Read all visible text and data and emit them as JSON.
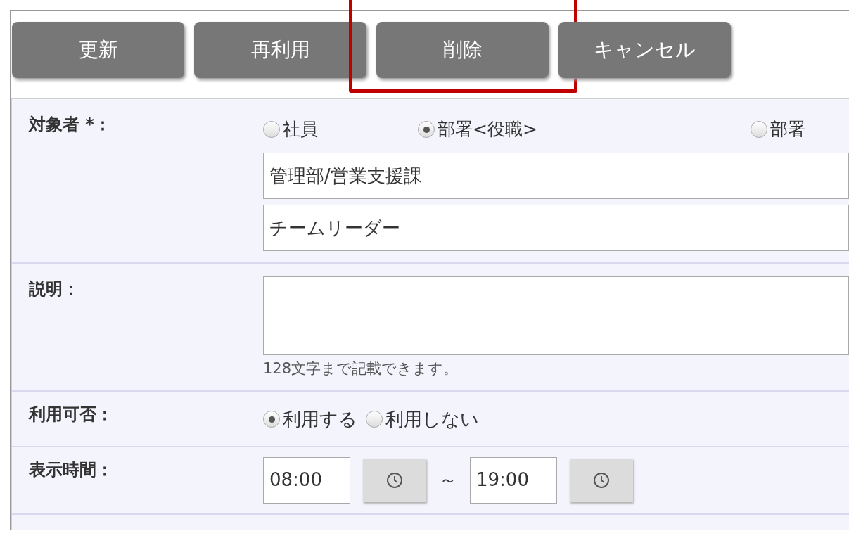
{
  "buttons": [
    {
      "label": "更新",
      "highlighted": false
    },
    {
      "label": "再利用",
      "highlighted": false
    },
    {
      "label": "削除",
      "highlighted": true
    },
    {
      "label": "キャンセル",
      "highlighted": false
    }
  ],
  "form": {
    "rows": [
      {
        "kind": "target",
        "label": "対象者 *：",
        "options": [
          {
            "label": "社員",
            "selected": false
          },
          {
            "label": "部署<役職>",
            "selected": true
          },
          {
            "label": "部署",
            "selected": false
          }
        ],
        "fields": [
          "管理部/営業支援課",
          "チームリーダー"
        ]
      },
      {
        "kind": "textarea",
        "label": "説明：",
        "note": "128文字まで記載できます。"
      },
      {
        "kind": "radio",
        "label": "利用可否：",
        "options": [
          {
            "label": "利用する",
            "selected": true
          },
          {
            "label": "利用しない",
            "selected": false
          }
        ]
      },
      {
        "kind": "time",
        "label": "表示時間：",
        "from": "08:00",
        "separator": "～",
        "to": "19:00"
      }
    ]
  }
}
